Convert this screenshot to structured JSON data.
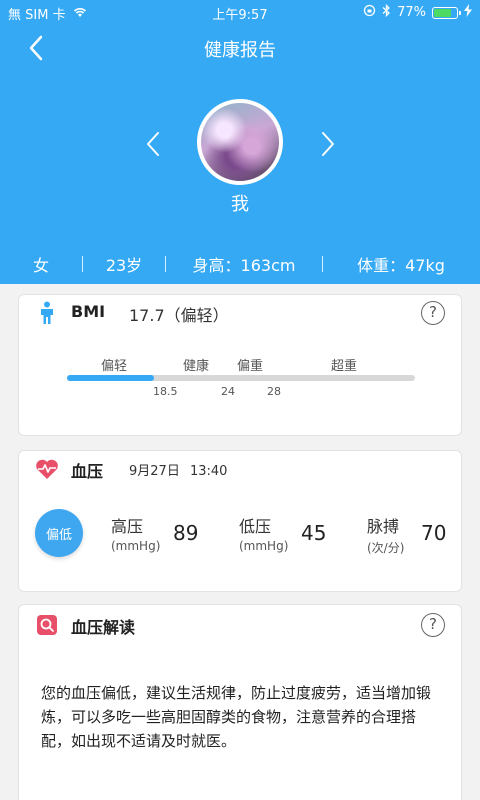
{
  "status_bar": {
    "carrier": "無 SIM 卡",
    "time": "上午9:57",
    "battery": "77%",
    "battery_level": 0.77
  },
  "nav": {
    "title": "健康报告",
    "back_icon": "chevron-left-icon"
  },
  "profile": {
    "name": "我"
  },
  "stats": {
    "gender": "女",
    "age": "23岁",
    "height": "身高：163cm",
    "weight": "体重：47kg"
  },
  "bmi": {
    "label": "BMI",
    "value": "17.7（偏轻）",
    "help": "?",
    "categories": [
      "偏轻",
      "健康",
      "偏重",
      "超重"
    ],
    "thresholds": [
      "18.5",
      "24",
      "28"
    ],
    "progress": 0.25,
    "color": "#36a9f5"
  },
  "blood_pressure": {
    "title": "血压",
    "date": "9月27日",
    "time": "13:40",
    "status": "偏低",
    "systolic": {
      "label": "高压",
      "unit": "(mmHg)",
      "value": "89"
    },
    "diastolic": {
      "label": "低压",
      "unit": "(mmHg)",
      "value": "45"
    },
    "pulse": {
      "label": "脉搏",
      "unit": "(次/分)",
      "value": "70"
    },
    "accent": "#e8506a"
  },
  "interpretation": {
    "title": "血压解读",
    "help": "?",
    "text": "您的血压偏低，建议生活规律，防止过度疲劳，适当增加锻炼，可以多吃一些高胆固醇类的食物，注意营养的合理搭配，如出现不适请及时就医。"
  },
  "colors": {
    "header": "#36a9f5",
    "background": "#f2f2f2"
  }
}
